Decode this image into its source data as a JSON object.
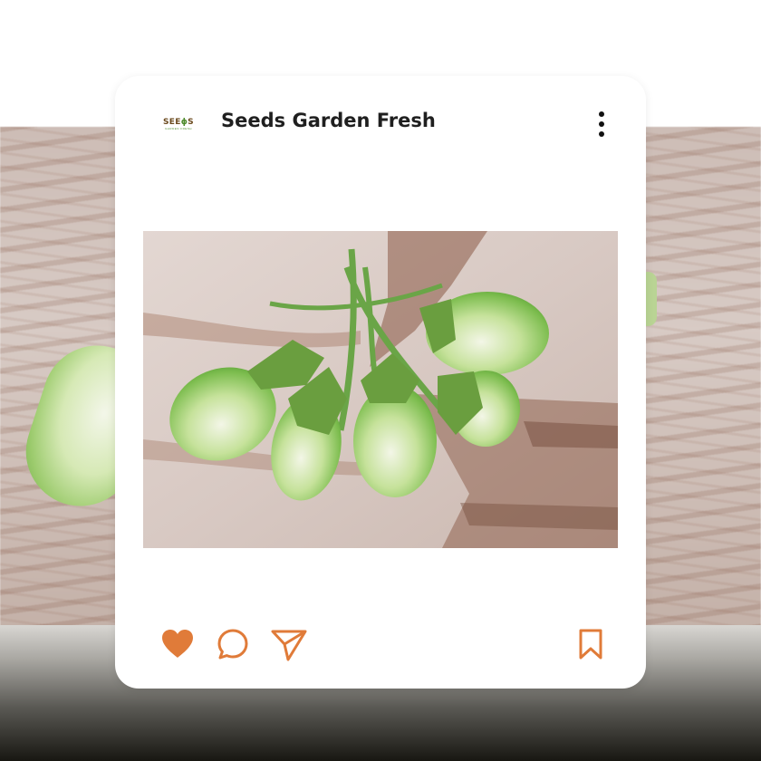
{
  "post": {
    "account_name": "Seeds Garden Fresh",
    "logo": {
      "word_prefix": "SEE",
      "word_icon": "ϕ",
      "word_suffix": "S",
      "tagline": "GARDEN FRESH"
    },
    "more_icon": "more-vertical-icon",
    "image_subject": "green-eggplants-photo"
  },
  "actions": {
    "like_icon": "heart-icon",
    "comment_icon": "comment-bubble-icon",
    "share_icon": "send-icon",
    "save_icon": "bookmark-icon",
    "liked": true
  },
  "colors": {
    "accent": "#e07b39",
    "text": "#1f1f1f",
    "card": "#ffffff"
  }
}
